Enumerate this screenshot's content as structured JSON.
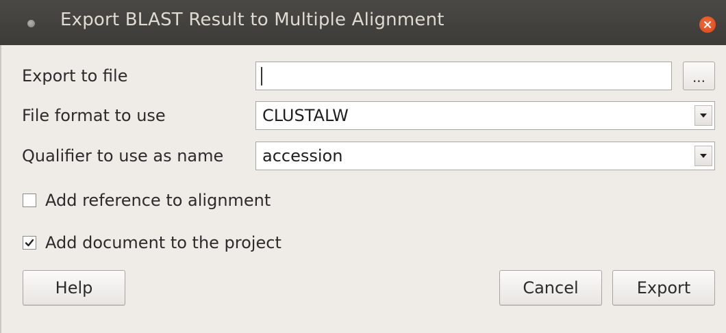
{
  "window": {
    "title": "Export BLAST Result to Multiple Alignment",
    "close_icon": "close-x-icon"
  },
  "form": {
    "export_to_file": {
      "label": "Export to file",
      "value": "",
      "browse_label": "..."
    },
    "file_format": {
      "label": "File format to use",
      "selected": "CLUSTALW"
    },
    "qualifier": {
      "label": "Qualifier to use as name",
      "selected": "accession"
    },
    "add_reference": {
      "label": "Add reference to alignment",
      "checked": false
    },
    "add_document": {
      "label": "Add document to the project",
      "checked": true
    }
  },
  "buttons": {
    "help": "Help",
    "cancel": "Cancel",
    "export": "Export"
  },
  "colors": {
    "titlebar": "#3c3b37",
    "close": "#df4a16",
    "background": "#efebe7"
  }
}
